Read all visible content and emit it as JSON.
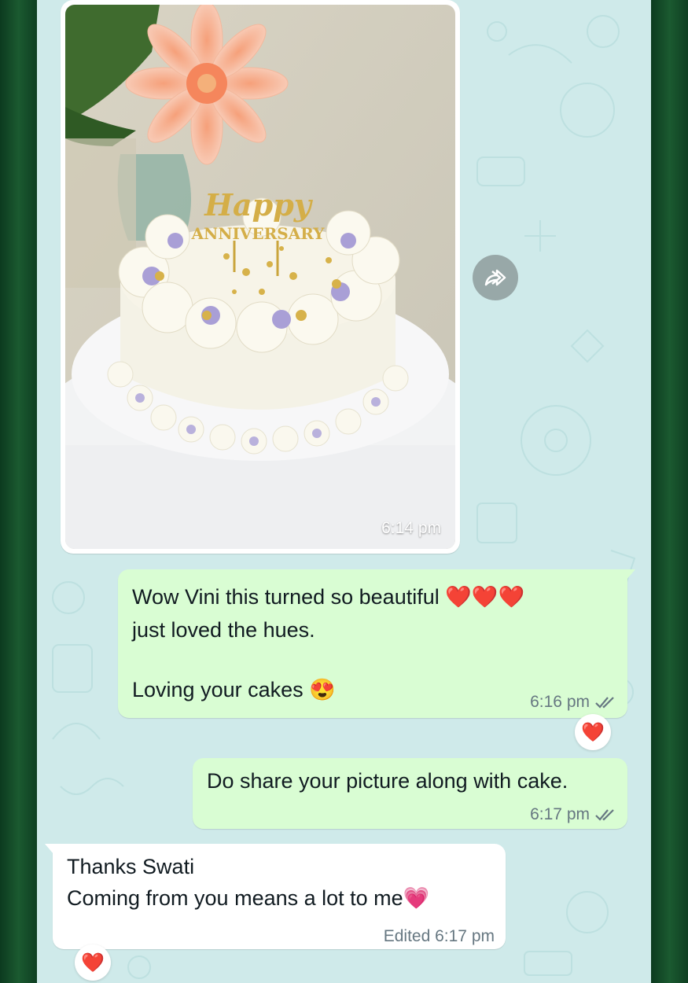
{
  "messages": {
    "image": {
      "time": "6:14 pm",
      "topper": "Happy ANNIVERSARY"
    },
    "msg1": {
      "line1": "Wow Vini this turned so beautiful ❤️❤️❤️",
      "line2": "just loved the hues.",
      "line3": "Loving your cakes 😍",
      "time": "6:16 pm",
      "reaction": "❤️"
    },
    "msg2": {
      "text": "Do share your picture along with cake.",
      "time": "6:17 pm"
    },
    "msg3": {
      "line1": "Thanks Swati",
      "line2": "Coming from you means a lot to me💗",
      "meta": "Edited 6:17 pm",
      "reaction": "❤️"
    }
  },
  "icons": {
    "forward": "forward-icon",
    "read": "double-check-icon"
  },
  "colors": {
    "chat_bg": "#cfeaea",
    "outgoing": "#d9fdd3",
    "incoming": "#ffffff",
    "frame": "#0f3d22"
  }
}
